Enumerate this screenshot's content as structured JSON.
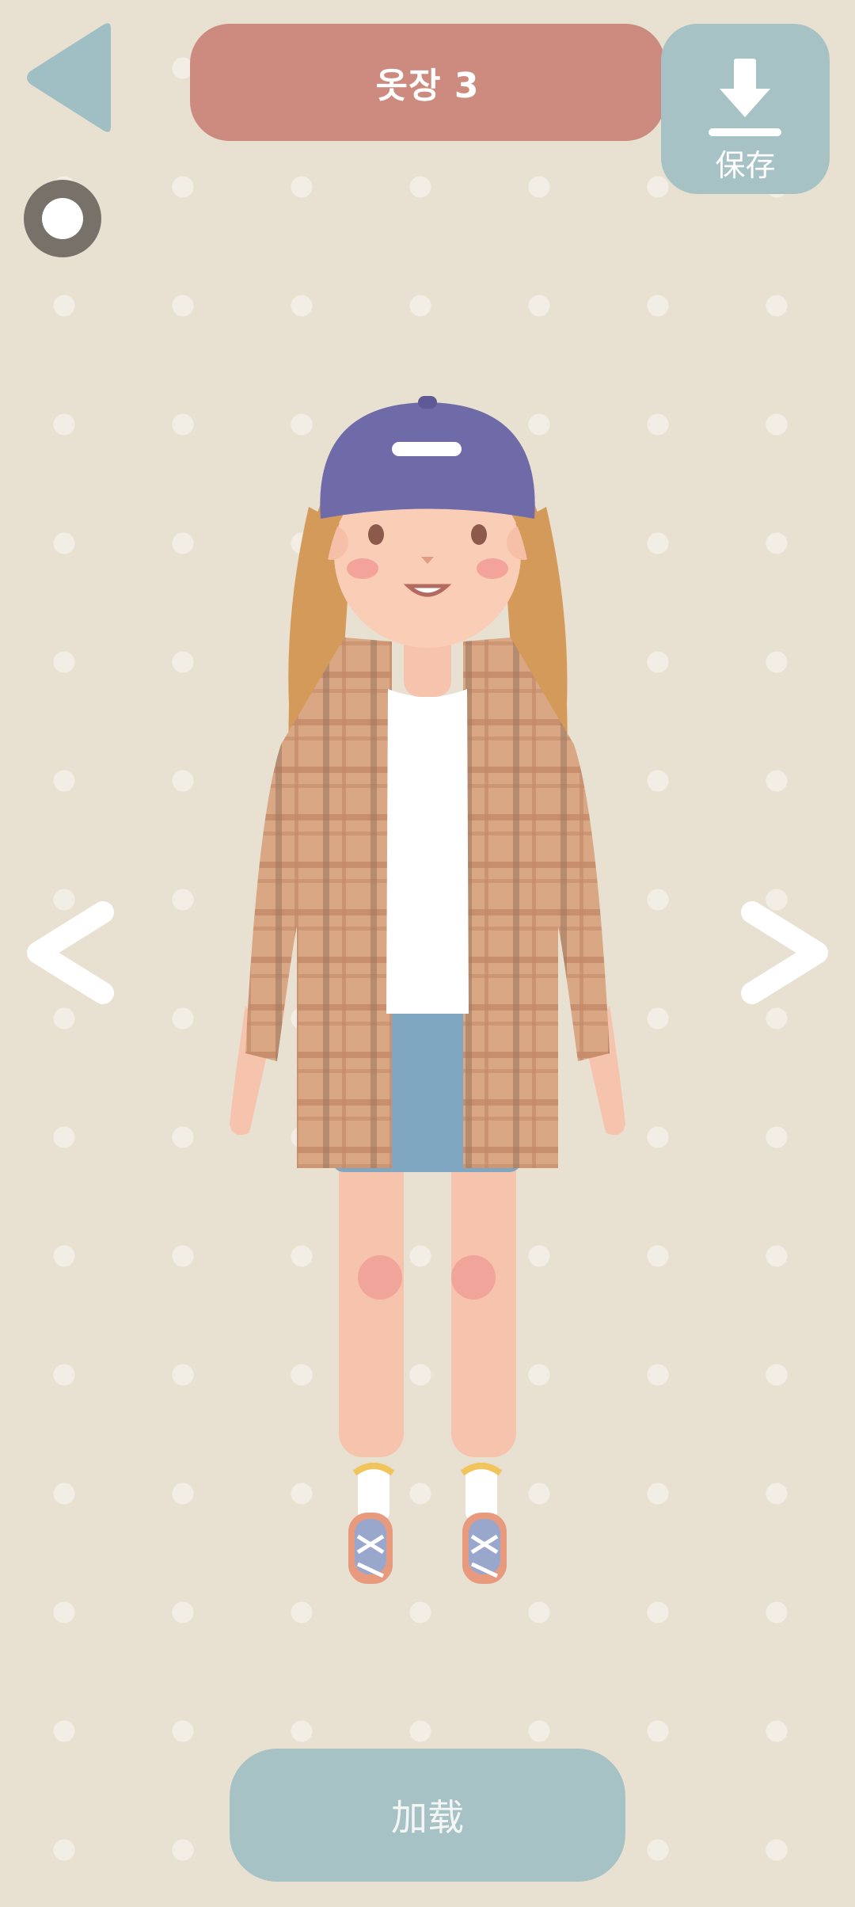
{
  "header": {
    "title": "옷장 3",
    "save_label": "保存",
    "back_icon": "back-triangle-icon",
    "save_icon": "download-icon"
  },
  "controls": {
    "toggle_icon": "ring-toggle-icon",
    "prev_icon": "chevron-left-icon",
    "next_icon": "chevron-right-icon"
  },
  "footer": {
    "load_label": "加载"
  },
  "colors": {
    "background": "#e8e0d1",
    "title_bar": "#cd8b80",
    "button_teal": "#a7c2c5",
    "back_arrow": "#9fbfc4"
  }
}
